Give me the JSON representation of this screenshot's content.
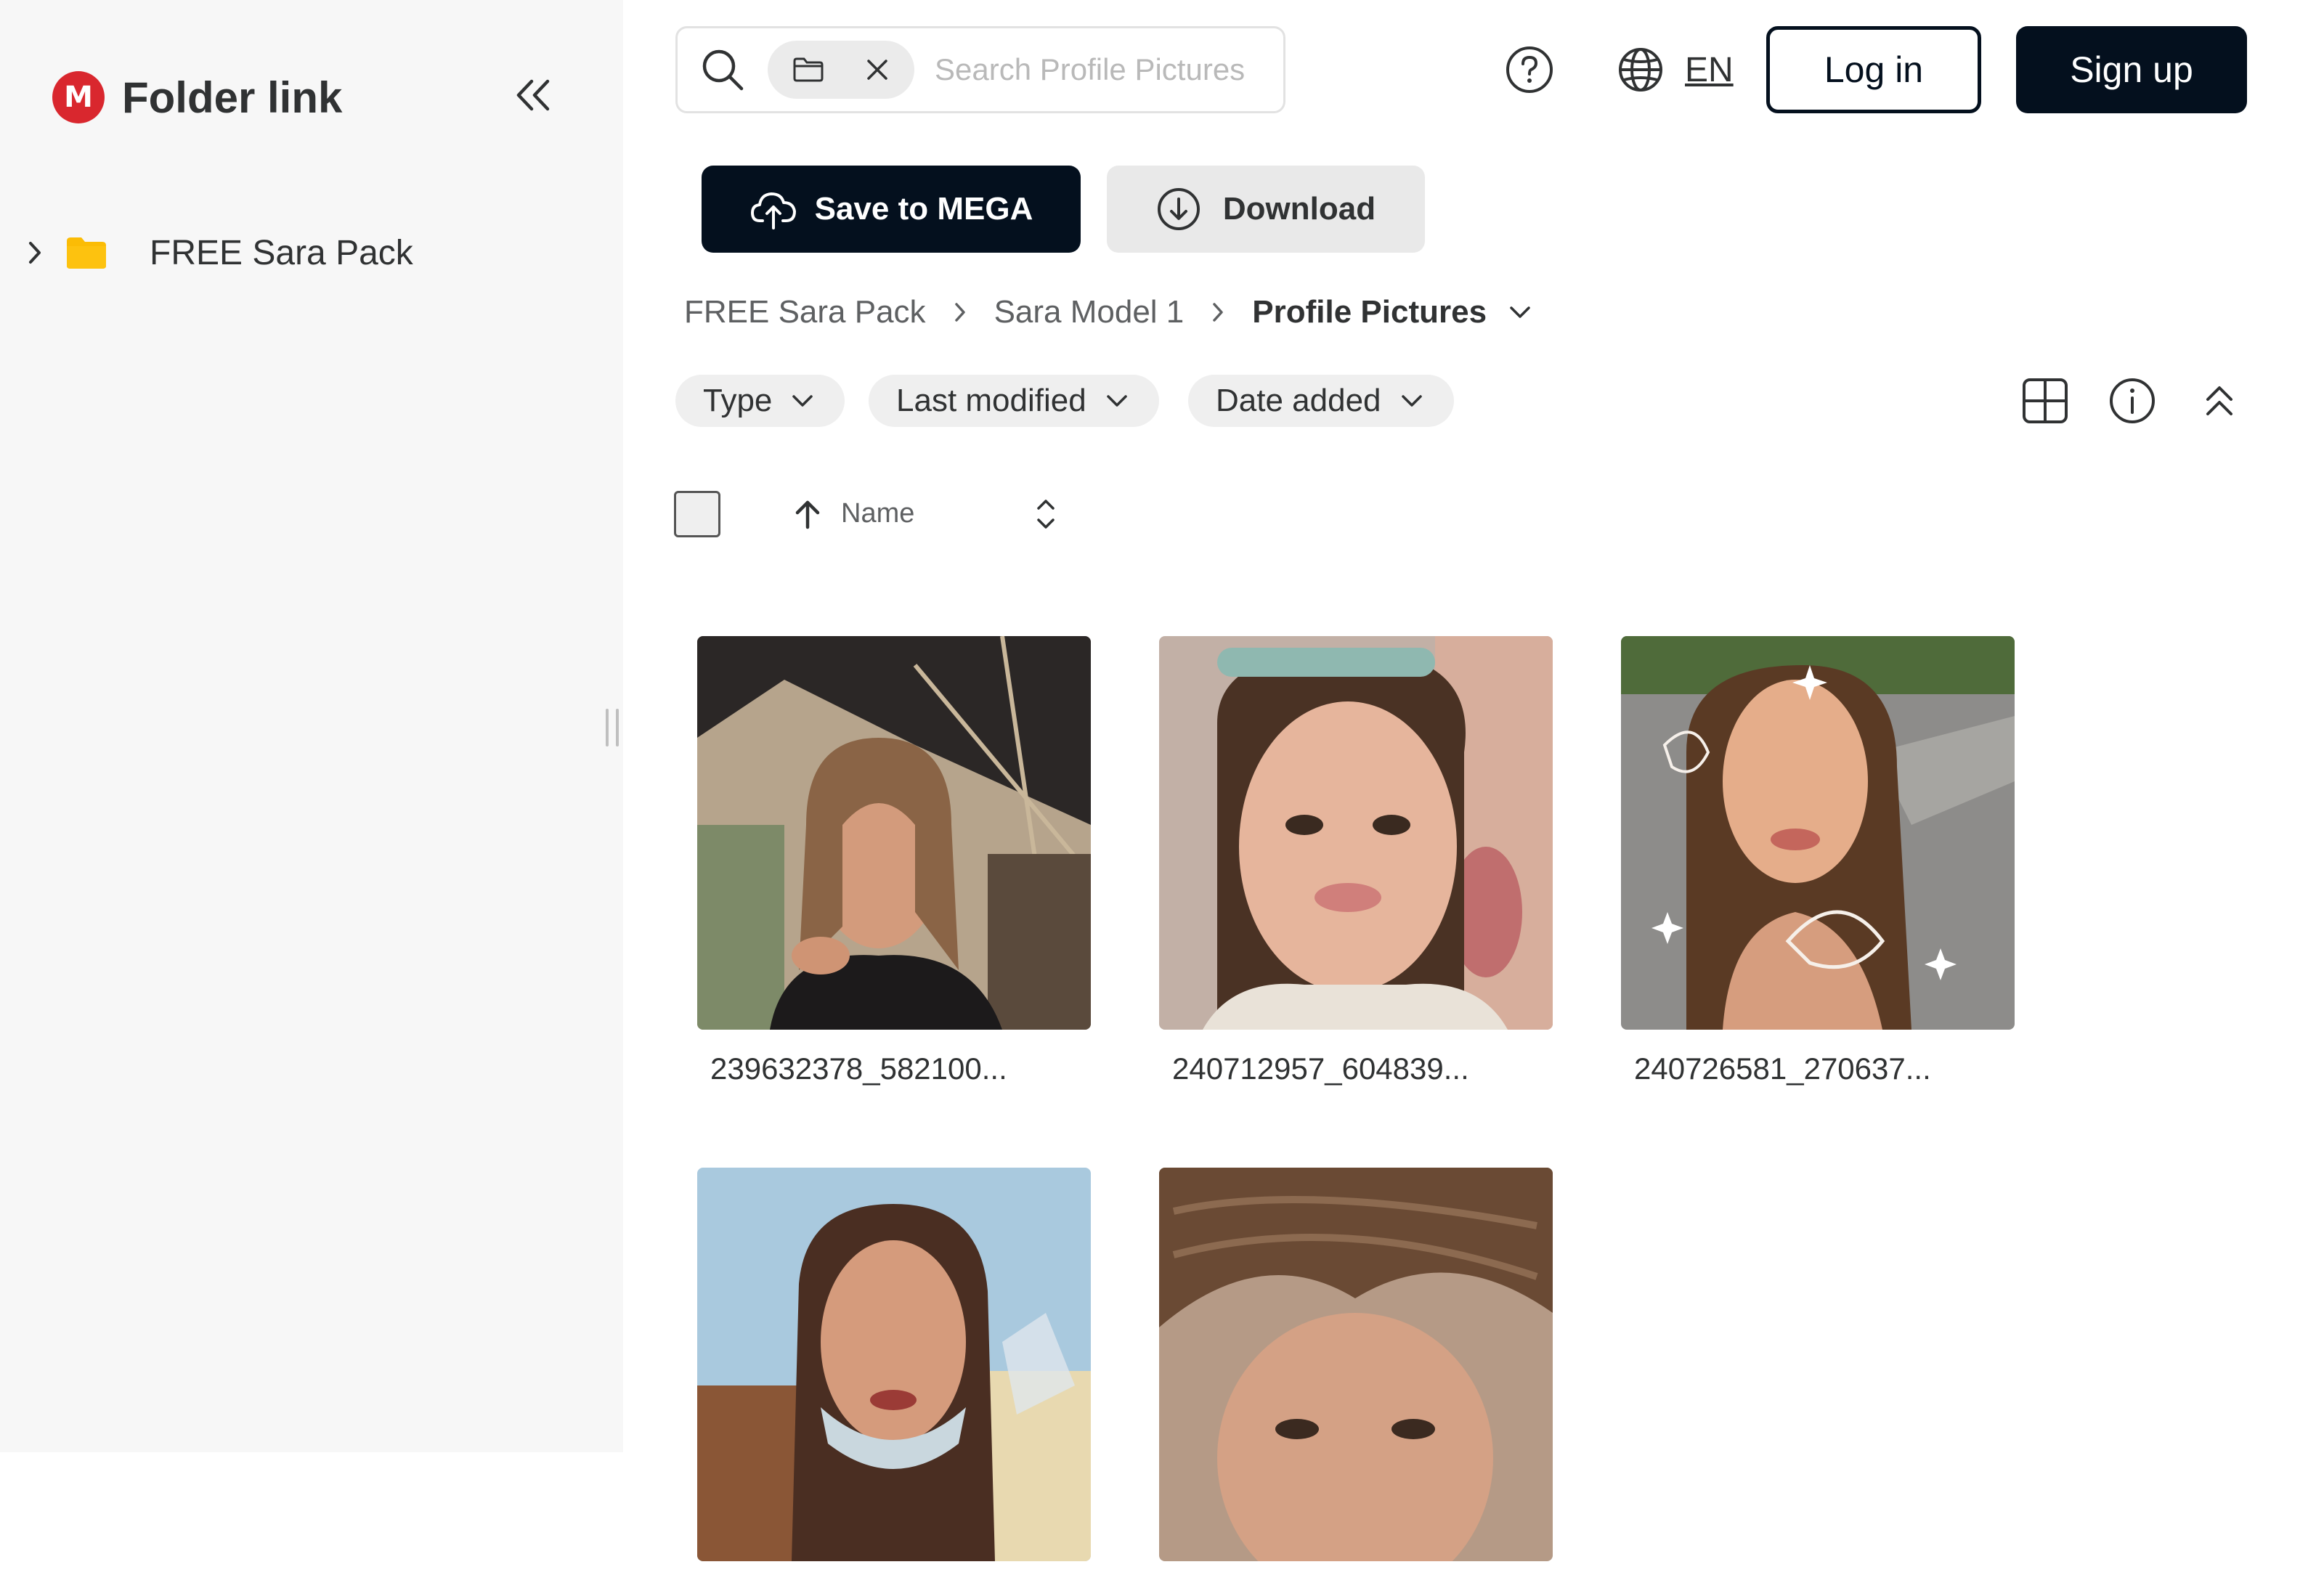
{
  "sidebar": {
    "brand_title": "Folder link",
    "brand_logo_letter": "M",
    "tree": [
      {
        "label": "FREE Sara Pack",
        "icon": "folder-icon",
        "color": "#fbbc05"
      }
    ]
  },
  "header": {
    "search_placeholder": "Search Profile Pictures",
    "language": "EN",
    "login_label": "Log in",
    "signup_label": "Sign up"
  },
  "actions": {
    "save_label": "Save to MEGA",
    "download_label": "Download"
  },
  "breadcrumb": [
    "FREE Sara Pack",
    "Sara Model 1",
    "Profile Pictures"
  ],
  "filters": [
    "Type",
    "Last modified",
    "Date added"
  ],
  "list": {
    "sort_column": "Name",
    "files": [
      {
        "name": "239632378_582100...",
        "type": "image"
      },
      {
        "name": "240712957_604839...",
        "type": "image"
      },
      {
        "name": "240726581_270637...",
        "type": "image"
      },
      {
        "name": "",
        "type": "image"
      },
      {
        "name": "",
        "type": "image"
      }
    ]
  },
  "colors": {
    "accent": "#04101e",
    "brand_red": "#d9272e",
    "folder_yellow": "#fbbc05",
    "sidebar_bg": "#f7f7f7"
  }
}
